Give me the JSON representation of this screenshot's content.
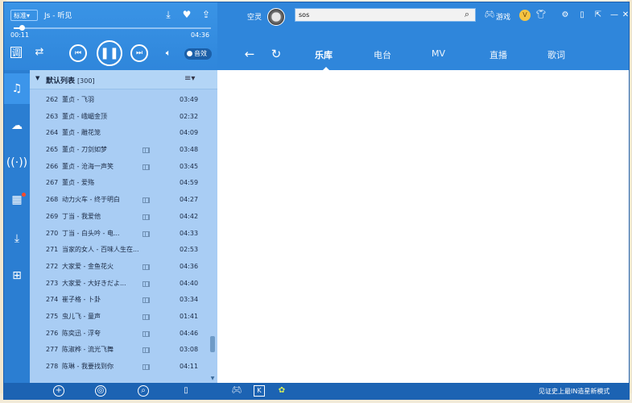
{
  "player": {
    "mode_label": "标准▾",
    "song_title": "Js - 听见",
    "time_elapsed": "00:11",
    "time_total": "04:36",
    "progress": 0.04,
    "sound_effect_label": "音效"
  },
  "header": {
    "user_name": "空灵",
    "search_value": "sos",
    "games_label": "游戏",
    "tabs": [
      {
        "label": "乐库",
        "active": true
      },
      {
        "label": "电台",
        "active": false
      },
      {
        "label": "MV",
        "active": false
      },
      {
        "label": "直播",
        "active": false
      },
      {
        "label": "歌词",
        "active": false
      }
    ]
  },
  "playlist": {
    "title": "默认列表",
    "count": "[300]",
    "rows": [
      {
        "num": "262",
        "name": "董贞 - 飞羽",
        "mv": false,
        "duration": "03:49"
      },
      {
        "num": "263",
        "name": "董贞 - 峨嵋金顶",
        "mv": false,
        "duration": "02:32"
      },
      {
        "num": "264",
        "name": "董贞 - 雕花笼",
        "mv": false,
        "duration": "04:09"
      },
      {
        "num": "265",
        "name": "董贞 - 刀剑如梦",
        "mv": true,
        "duration": "03:48"
      },
      {
        "num": "266",
        "name": "董贞 - 沧海一声笑",
        "mv": true,
        "duration": "03:45"
      },
      {
        "num": "267",
        "name": "董贞 - 爱殇",
        "mv": false,
        "duration": "04:59"
      },
      {
        "num": "268",
        "name": "动力火车 - 终于明白",
        "mv": true,
        "duration": "04:27"
      },
      {
        "num": "269",
        "name": "丁当 - 我爱他",
        "mv": true,
        "duration": "04:42"
      },
      {
        "num": "270",
        "name": "丁当 - 白头吟 - 电...",
        "mv": true,
        "duration": "04:33"
      },
      {
        "num": "271",
        "name": "当家的女人 - 百味人生在...",
        "mv": false,
        "duration": "02:53"
      },
      {
        "num": "272",
        "name": "大家爱 - 金鱼花火",
        "mv": true,
        "duration": "04:36"
      },
      {
        "num": "273",
        "name": "大家爱 - 大好きだよ...",
        "mv": true,
        "duration": "04:40"
      },
      {
        "num": "274",
        "name": "崔子格 - 卜卦",
        "mv": true,
        "duration": "03:34"
      },
      {
        "num": "275",
        "name": "虫儿飞 - 童声",
        "mv": true,
        "duration": "01:41"
      },
      {
        "num": "276",
        "name": "陈奕迅 - 浮夸",
        "mv": true,
        "duration": "04:46"
      },
      {
        "num": "277",
        "name": "陈淑桦 - 流光飞舞",
        "mv": true,
        "duration": "03:08"
      },
      {
        "num": "278",
        "name": "陈琳 - 我要找到你",
        "mv": true,
        "duration": "04:11"
      }
    ]
  },
  "bottom": {
    "status_text": "见证史上最IN造星新模式"
  },
  "icons": {
    "download": "download-icon",
    "favorite": "heart-icon",
    "share": "share-icon",
    "prev": "previous-track-icon",
    "play_pause": "pause-icon",
    "next": "next-track-icon",
    "volume": "volume-icon"
  },
  "colors": {
    "accent": "#2f86db",
    "panel": "#a9cdf4",
    "bottom_bar": "#1c63b3"
  }
}
